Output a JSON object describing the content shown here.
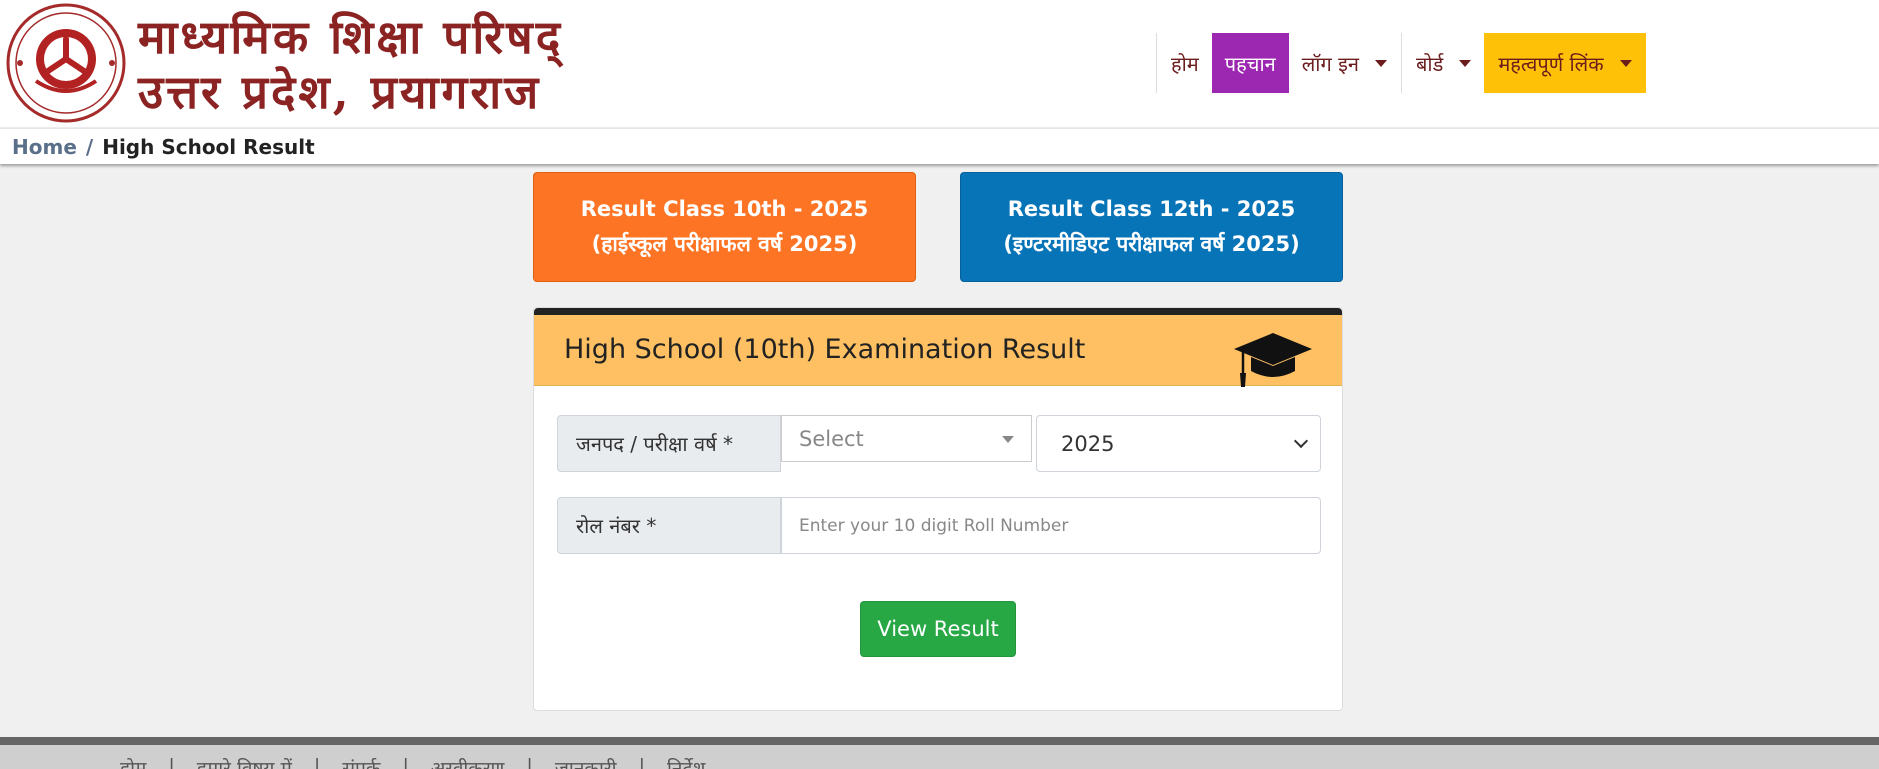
{
  "header": {
    "emblem_text": "माध्यमिक शिक्षा परिषद उत्तर प्रदेश",
    "title_line1": "माध्यमिक शिक्षा परिषद्",
    "title_line2": "उत्तर प्रदेश, प्रयागराज"
  },
  "nav": {
    "home": "होम",
    "identity": "पहचान",
    "login": "लॉग इन",
    "board": "बोर्ड",
    "important_links": "महत्वपूर्ण लिंक"
  },
  "breadcrumb": {
    "home": "Home",
    "separator": "/",
    "current": "High School Result"
  },
  "result_buttons": {
    "class10_line1": "Result Class 10th - 2025",
    "class10_line2": "(हाईस्कूल परीक्षाफल वर्ष 2025)",
    "class12_line1": "Result Class 12th - 2025",
    "class12_line2": "(इण्टरमीडिएट परीक्षाफल वर्ष 2025)"
  },
  "form": {
    "title": "High School (10th) Examination Result",
    "district_year_label": "जनपद / परीक्षा वर्ष *",
    "district_value": "Select",
    "year_value": "2025",
    "roll_label": "रोल नंबर *",
    "roll_placeholder": "Enter your 10 digit Roll Number",
    "submit_label": "View Result"
  },
  "footer": {
    "links": [
      "होम",
      "हमारे विषय में",
      "संपर्क",
      "अस्वीकरण",
      "जानकारी",
      "निर्देश"
    ]
  },
  "colors": {
    "title_maroon": "#8b2323",
    "nav_active": "#9c27b0",
    "nav_highlight": "#ffc107",
    "class10": "#fd7424",
    "class12": "#0874b8",
    "card_header": "#fec063",
    "submit": "#28a745"
  }
}
